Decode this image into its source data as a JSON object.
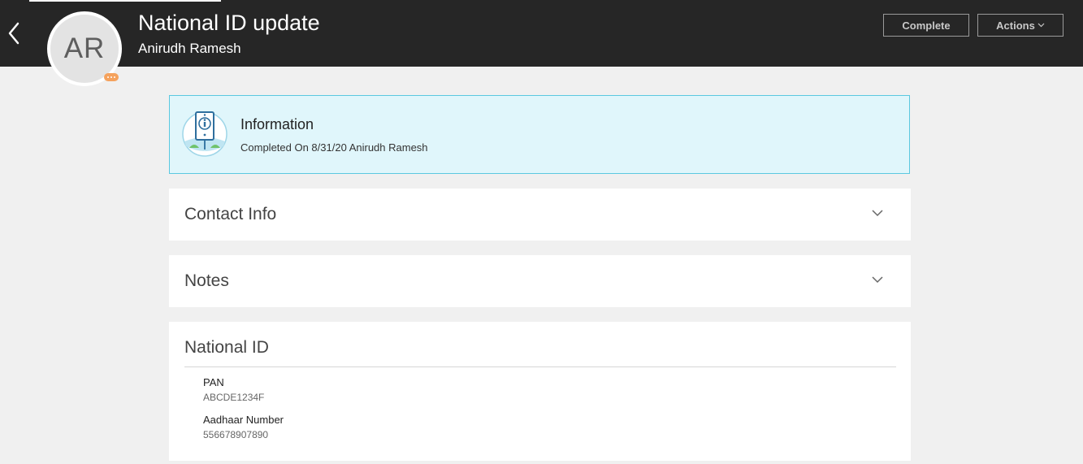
{
  "header": {
    "title": "National ID update",
    "subtitle": "Anirudh Ramesh",
    "avatar_initials": "AR",
    "complete_label": "Complete",
    "actions_label": "Actions"
  },
  "banner": {
    "title": "Information",
    "text": "Completed On 8/31/20 Anirudh Ramesh",
    "icon": "info-sign-icon"
  },
  "sections": {
    "contact_info": {
      "title": "Contact Info"
    },
    "notes": {
      "title": "Notes"
    },
    "national_id": {
      "title": "National ID",
      "fields": [
        {
          "label": "PAN",
          "value": "ABCDE1234F"
        },
        {
          "label": "Aadhaar Number",
          "value": "556678907890"
        }
      ]
    }
  },
  "colors": {
    "header_bg": "#262626",
    "page_bg": "#f0f0f0",
    "banner_bg": "#e0f6fb",
    "banner_border": "#5bc8e0",
    "badge": "#f5a25d"
  }
}
